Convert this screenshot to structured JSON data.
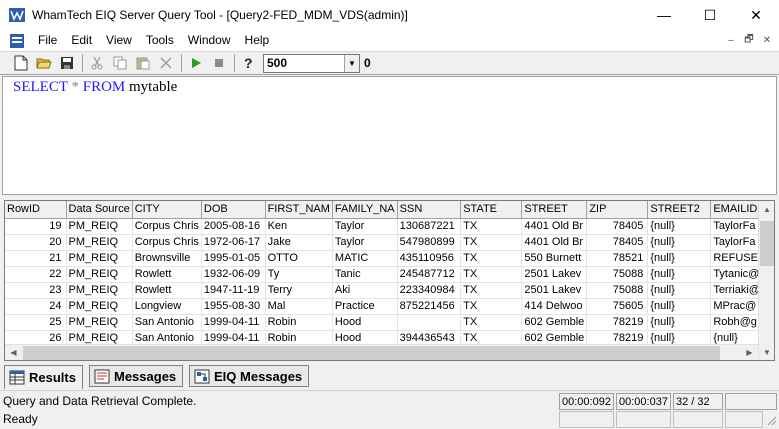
{
  "window": {
    "title": "WhamTech EIQ Server Query Tool - [Query2-FED_MDM_VDS(admin)]",
    "minimize": "—",
    "maximize": "☐",
    "close": "✕"
  },
  "menu": {
    "items": [
      "File",
      "Edit",
      "View",
      "Tools",
      "Window",
      "Help"
    ],
    "mdi_minimize": "–",
    "mdi_restore": "🗗",
    "mdi_close": "✕"
  },
  "toolbar": {
    "row_limit": "500",
    "count": "0",
    "icons": [
      "new-icon",
      "open-icon",
      "save-icon",
      "cut-icon",
      "copy-icon",
      "paste-icon",
      "delete-icon",
      "run-icon",
      "stop-icon",
      "help-icon"
    ]
  },
  "editor": {
    "keyword_select": "SELECT",
    "star": "*",
    "keyword_from": "FROM",
    "table": "mytable"
  },
  "grid": {
    "columns": [
      "RowID",
      "Data Source",
      "CITY",
      "DOB",
      "FIRST_NAM",
      "FAMILY_NA",
      "SSN",
      "STATE",
      "STREET",
      "ZIP",
      "STREET2",
      "EMAILID"
    ],
    "rows": [
      [
        "19",
        "PM_REIQ",
        "Corpus Chris",
        "2005-08-16",
        "Ken",
        "Taylor",
        "130687221",
        "TX",
        "4401 Old Br",
        "78405",
        "{null}",
        "TaylorFa"
      ],
      [
        "20",
        "PM_REIQ",
        "Corpus Chris",
        "1972-06-17",
        "Jake",
        "Taylor",
        "547980899",
        "TX",
        "4401 Old Br",
        "78405",
        "{null}",
        "TaylorFa"
      ],
      [
        "21",
        "PM_REIQ",
        "Brownsville",
        "1995-01-05",
        "OTTO",
        "MATIC",
        "435110956",
        "TX",
        "550 Burnett",
        "78521",
        "{null}",
        "REFUSE"
      ],
      [
        "22",
        "PM_REIQ",
        "Rowlett",
        "1932-06-09",
        "Ty",
        "Tanic",
        "245487712",
        "TX",
        "2501 Lakev",
        "75088",
        "{null}",
        "Tytanic@"
      ],
      [
        "23",
        "PM_REIQ",
        "Rowlett",
        "1947-11-19",
        "Terry",
        "Aki",
        "223340984",
        "TX",
        "2501 Lakev",
        "75088",
        "{null}",
        "Terriaki@"
      ],
      [
        "24",
        "PM_REIQ",
        "Longview",
        "1955-08-30",
        "Mal",
        "Practice",
        "875221456",
        "TX",
        "414 Delwoo",
        "75605",
        "{null}",
        "MPrac@"
      ],
      [
        "25",
        "PM_REIQ",
        "San Antonio",
        "1999-04-11",
        "Robin",
        "Hood",
        "",
        "TX",
        "602 Gemble",
        "78219",
        "{null}",
        "Robh@g"
      ],
      [
        "26",
        "PM_REIQ",
        "San Antonio",
        "1999-04-11",
        "Robin",
        "Hood",
        "394436543",
        "TX",
        "602 Gemble",
        "78219",
        "{null}",
        "{null}"
      ]
    ],
    "right_aligned": [
      0,
      9
    ]
  },
  "tabs": [
    {
      "label": "Results",
      "icon": "results-grid-icon",
      "active": true
    },
    {
      "label": "Messages",
      "icon": "messages-icon",
      "active": false
    },
    {
      "label": "EIQ Messages",
      "icon": "eiq-messages-icon",
      "active": false
    }
  ],
  "status": {
    "message": "Query and Data Retrieval Complete.",
    "time1": "00:00:092",
    "time2": "00:00:037",
    "rows": "32 / 32",
    "ready": "Ready"
  }
}
